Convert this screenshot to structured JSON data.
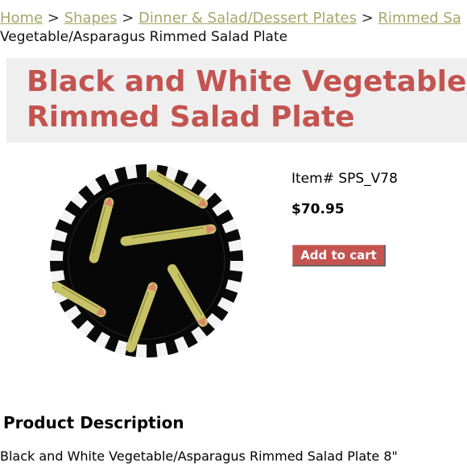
{
  "breadcrumb": {
    "items": [
      {
        "label": "Home"
      },
      {
        "label": "Shapes"
      },
      {
        "label": "Dinner & Salad/Dessert Plates"
      },
      {
        "label": "Rimmed Sa"
      }
    ],
    "separator": ">",
    "current": "Vegetable/Asparagus Rimmed Salad Plate"
  },
  "product": {
    "title_line1": "Black and White Vegetable/",
    "title_line2": "Rimmed Salad Plate",
    "item_number": "Item# SPS_V78",
    "price": "$70.95",
    "add_to_cart_label": "Add to cart",
    "image_icon": "plate-image"
  },
  "description": {
    "heading": "Product Description",
    "text": "Black and White Vegetable/Asparagus Rimmed Salad Plate 8\""
  },
  "colors": {
    "title": "#c35450",
    "breadcrumb_link": "#a2a86a",
    "button": "#c35450",
    "title_box": "#efefef"
  }
}
